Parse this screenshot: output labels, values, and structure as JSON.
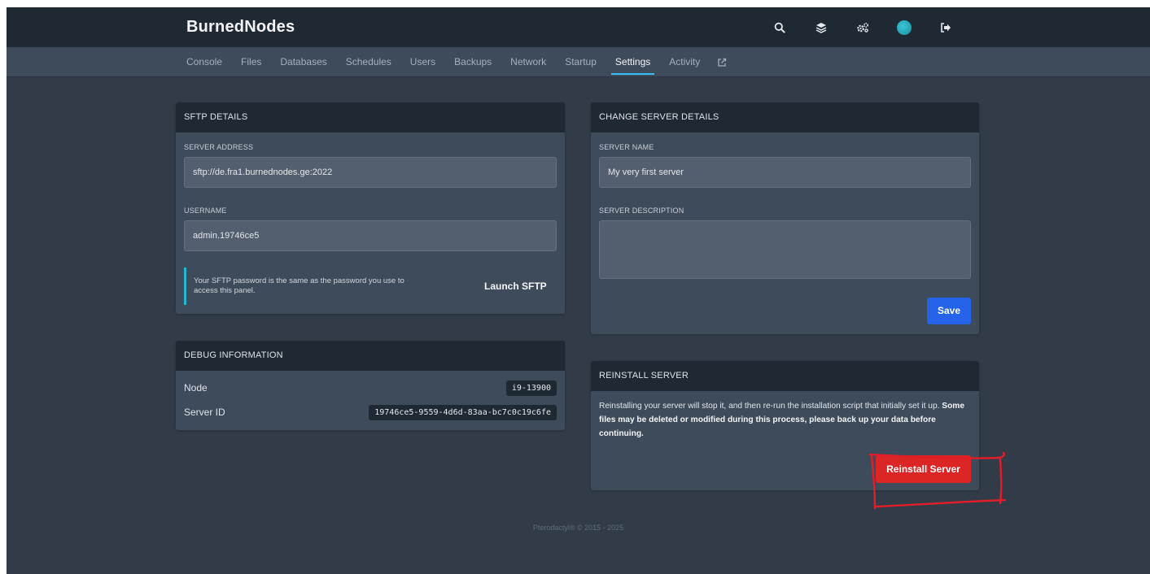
{
  "app": {
    "brand": "BurnedNodes"
  },
  "header": {
    "icons": [
      "search-icon",
      "layers-icon",
      "cogs-icon",
      "avatar",
      "logout-icon"
    ]
  },
  "nav": {
    "tabs": [
      "Console",
      "Files",
      "Databases",
      "Schedules",
      "Users",
      "Backups",
      "Network",
      "Startup",
      "Settings",
      "Activity"
    ],
    "active": "Settings",
    "external_icon": "external-link-icon"
  },
  "sftp": {
    "title": "SFTP DETAILS",
    "address_label": "SERVER ADDRESS",
    "address_value": "sftp://de.fra1.burnednodes.ge:2022",
    "username_label": "USERNAME",
    "username_value": "admin.19746ce5",
    "notice": "Your SFTP password is the same as the password you use to access this panel.",
    "launch_label": "Launch SFTP"
  },
  "debug": {
    "title": "DEBUG INFORMATION",
    "rows": [
      {
        "key": "Node",
        "value": "i9-13900"
      },
      {
        "key": "Server ID",
        "value": "19746ce5-9559-4d6d-83aa-bc7c0c19c6fe"
      }
    ]
  },
  "details": {
    "title": "CHANGE SERVER DETAILS",
    "name_label": "SERVER NAME",
    "name_value": "My very first server",
    "description_label": "SERVER DESCRIPTION",
    "description_value": "",
    "save_label": "Save"
  },
  "reinstall": {
    "title": "REINSTALL SERVER",
    "text_normal": "Reinstalling your server will stop it, and then re-run the installation script that initially set it up. ",
    "text_bold": "Some files may be deleted or modified during this process, please back up your data before continuing.",
    "button_label": "Reinstall Server",
    "annotation_color": "#e11d2a"
  },
  "footer": {
    "text": "Pterodactyl® © 2015 - 2025"
  },
  "colors": {
    "background": "#323c49",
    "header": "#1f2933",
    "panel": "#3e4b5b",
    "accent_tab": "#38bdf8",
    "save": "#2563eb",
    "danger": "#dc2626"
  }
}
